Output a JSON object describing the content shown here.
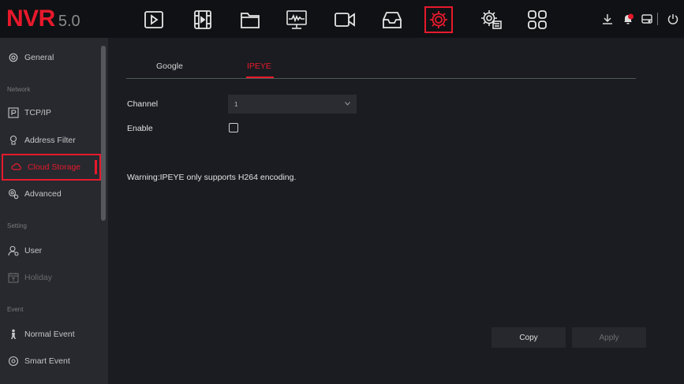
{
  "app": {
    "brand": "NVR",
    "version": "5.0"
  },
  "topnav": {
    "icons": [
      "playback-icon",
      "video-clip-icon",
      "folder-icon",
      "monitor-icon",
      "camera-icon",
      "storage-icon",
      "settings-icon",
      "system-settings-icon",
      "grid-layout-icon"
    ],
    "active_icon": "settings-icon",
    "right_icons": [
      "download-icon",
      "alarm-bell-icon",
      "disk-icon",
      "power-icon"
    ]
  },
  "sidebar": {
    "general": "General",
    "section_network": "Network",
    "tcpip": "TCP/IP",
    "address_filter": "Address Filter",
    "cloud_storage": "Cloud Storage",
    "advanced": "Advanced",
    "section_setting": "Setting",
    "user": "User",
    "holiday": "Holiday",
    "section_event": "Event",
    "normal_event": "Normal Event",
    "smart_event": "Smart Event"
  },
  "tabs": {
    "google": "Google",
    "ipeye": "IPEYE",
    "active": "IPEYE"
  },
  "form": {
    "channel_label": "Channel",
    "channel_value": "1",
    "enable_label": "Enable",
    "enable_checked": false,
    "warning": "Warning:IPEYE only supports H264 encoding."
  },
  "buttons": {
    "copy": "Copy",
    "apply": "Apply"
  },
  "colors": {
    "accent": "#e8192c",
    "background": "#1b1c21",
    "sidebar": "#27292f",
    "topbar": "#101114"
  }
}
